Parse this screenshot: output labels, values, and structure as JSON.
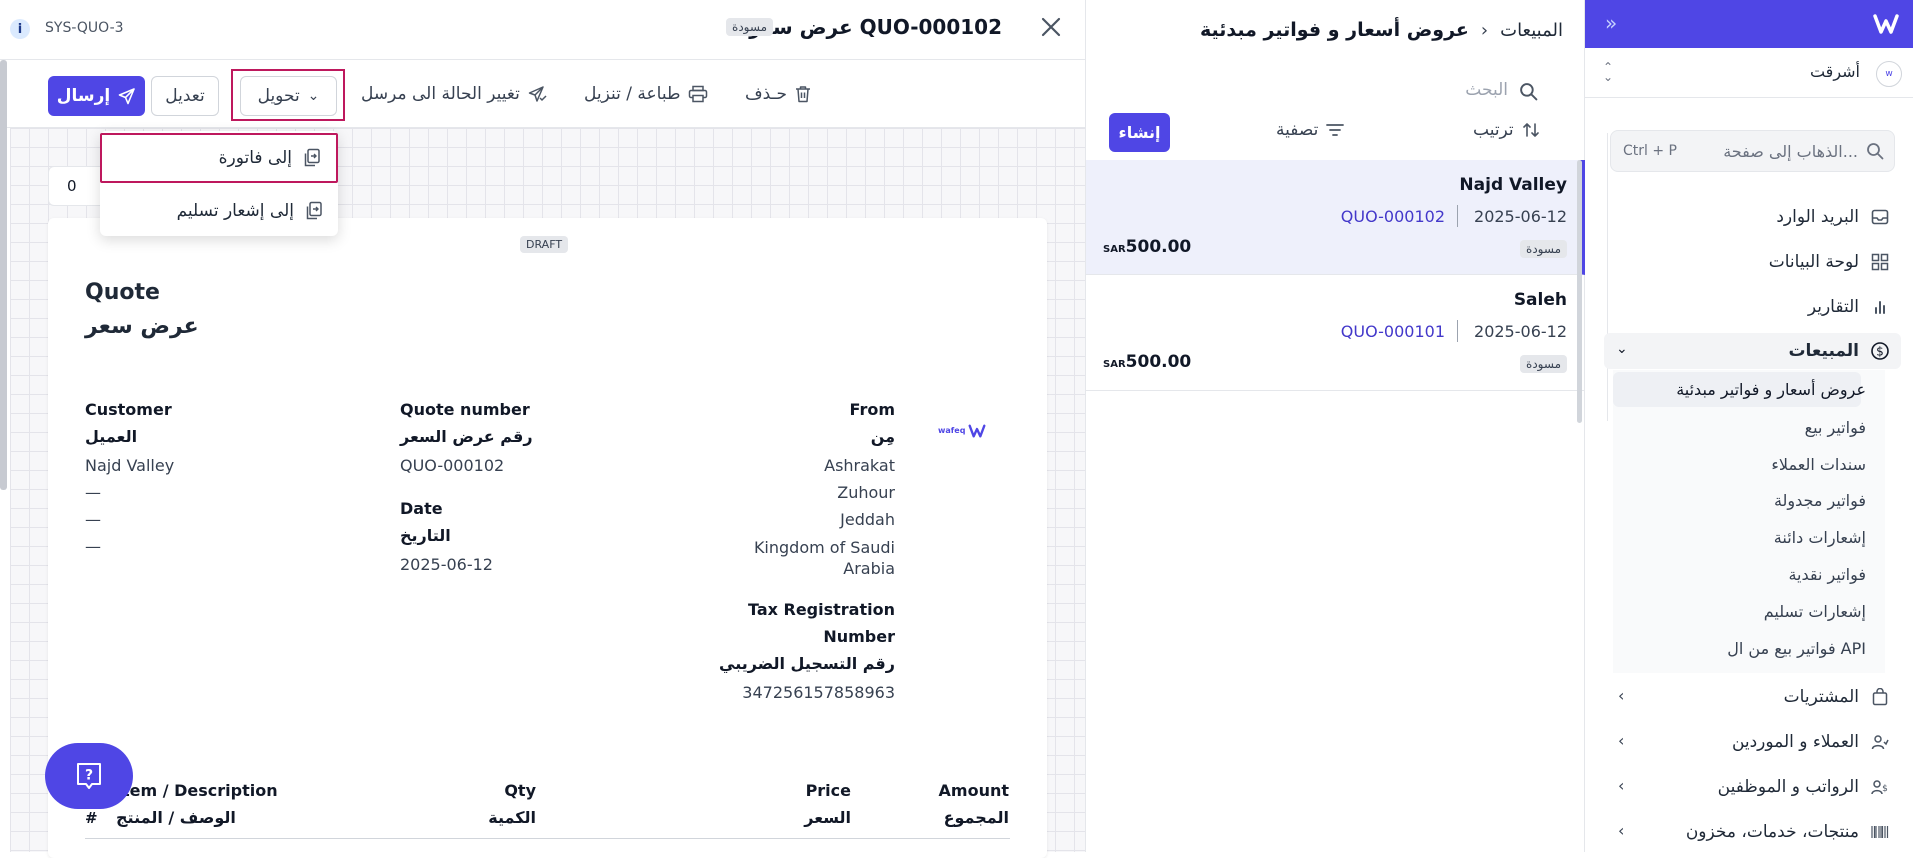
{
  "sidebar": {
    "collapse_icon": "double-chevron-right-icon",
    "logo_icon": "wafeq-logo-icon",
    "org_name": "أشرقت",
    "search_placeholder": "الذهاب إلى صفحة...",
    "search_shortcut": "Ctrl + P",
    "items": [
      {
        "label": "البريد الوارد",
        "icon": "inbox-icon"
      },
      {
        "label": "لوحة البيانات",
        "icon": "dashboard-icon"
      },
      {
        "label": "التقارير",
        "icon": "bar-chart-icon"
      },
      {
        "label": "المبيعات",
        "icon": "dollar-circle-icon"
      },
      {
        "label": "المشتريات",
        "icon": "shopping-bag-icon"
      },
      {
        "label": "العملاء و الموردين",
        "icon": "users-icon"
      },
      {
        "label": "الرواتب و الموظفين",
        "icon": "payroll-icon"
      },
      {
        "label": "منتجات، خدمات، مخزون",
        "icon": "barcode-icon"
      }
    ],
    "sales_sub": [
      "عروض أسعار و فواتير مبدئية",
      "فواتير بيع",
      "سندات العملاء",
      "فواتير مجدولة",
      "إشعارات دائنة",
      "فواتير نقدية",
      "إشعارات تسليم",
      "فواتير بيع من ال API"
    ]
  },
  "list": {
    "breadcrumb_parent": "المبيعات",
    "breadcrumb_current": "عروض أسعار و فواتير مبدئية",
    "search_placeholder": "البحث",
    "sort_label": "ترتيب",
    "filter_label": "تصفية",
    "create_label": "إنشاء",
    "cards": [
      {
        "name": "Najd Valley",
        "number": "QUO-000102",
        "date": "2025-06-12",
        "currency": "SAR",
        "amount": "500.00",
        "status": "مسودة"
      },
      {
        "name": "Saleh",
        "number": "QUO-000101",
        "date": "2025-06-12",
        "currency": "SAR",
        "amount": "500.00",
        "status": "مسودة"
      }
    ]
  },
  "detail": {
    "sys_id": "SYS-QUO-3",
    "title": "عرض سعر QUO-000102",
    "status_badge": "مسودة",
    "toolbar": {
      "delete": "حـذف",
      "print": "طباعة / تنزيل",
      "change_status": "تغيير الحالة الى مرسل",
      "convert": "تحويل",
      "edit": "تعديل",
      "send": "إرسال"
    },
    "convert_menu": [
      "إلى فاتورة",
      "إلى إشعار تسليم"
    ],
    "attachments_count": "0",
    "doc": {
      "draft": "DRAFT",
      "title_en": "Quote",
      "title_ar": "عرض سعر",
      "customer_en": "Customer",
      "customer_ar": "العميل",
      "customer_name": "Najd Valley",
      "dashes": [
        "—",
        "—",
        "—"
      ],
      "quote_number_en": "Quote number",
      "quote_number_ar": "رقم عرض السعر",
      "quote_number": "QUO-000102",
      "date_en": "Date",
      "date_ar": "التاريخ",
      "date": "2025-06-12",
      "from_en": "From",
      "from_ar": "مِن",
      "from_lines": [
        "Ashrakat",
        "Zuhour",
        "Jeddah",
        "Kingdom of Saudi",
        "Arabia"
      ],
      "trn_en_1": "Tax Registration",
      "trn_en_2": "Number",
      "trn_ar": "رقم التسجيل الضريبي",
      "trn": "347256157858963",
      "logo_text": "wafeq",
      "col_item_en": "Item / Description",
      "col_item_ar": "الوصف / المنتج",
      "col_hash": "#",
      "col_qty_en": "Qty",
      "col_qty_ar": "الكمية",
      "col_price_en": "Price",
      "col_price_ar": "السعر",
      "col_amount_en": "Amount",
      "col_amount_ar": "المجموع"
    }
  },
  "colors": {
    "primary": "#4f46e5",
    "highlight": "#be185d",
    "link": "#4338ca",
    "selected_bg": "#eef0fb"
  }
}
